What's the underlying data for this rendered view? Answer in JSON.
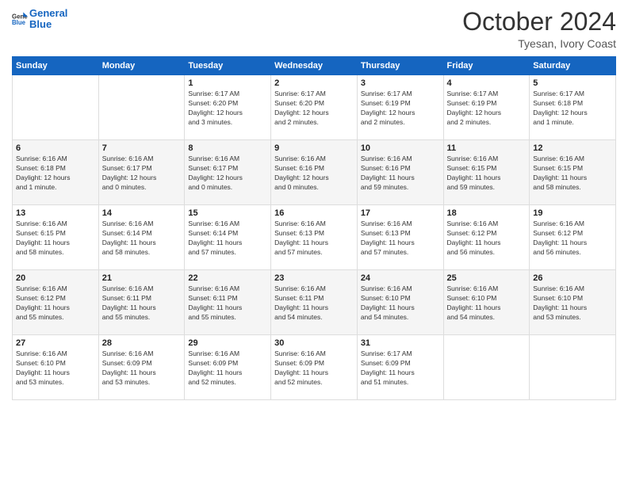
{
  "logo": {
    "line1": "General",
    "line2": "Blue"
  },
  "title": "October 2024",
  "location": "Tyesan, Ivory Coast",
  "weekdays": [
    "Sunday",
    "Monday",
    "Tuesday",
    "Wednesday",
    "Thursday",
    "Friday",
    "Saturday"
  ],
  "weeks": [
    [
      {
        "day": "",
        "info": ""
      },
      {
        "day": "",
        "info": ""
      },
      {
        "day": "1",
        "info": "Sunrise: 6:17 AM\nSunset: 6:20 PM\nDaylight: 12 hours\nand 3 minutes."
      },
      {
        "day": "2",
        "info": "Sunrise: 6:17 AM\nSunset: 6:20 PM\nDaylight: 12 hours\nand 2 minutes."
      },
      {
        "day": "3",
        "info": "Sunrise: 6:17 AM\nSunset: 6:19 PM\nDaylight: 12 hours\nand 2 minutes."
      },
      {
        "day": "4",
        "info": "Sunrise: 6:17 AM\nSunset: 6:19 PM\nDaylight: 12 hours\nand 2 minutes."
      },
      {
        "day": "5",
        "info": "Sunrise: 6:17 AM\nSunset: 6:18 PM\nDaylight: 12 hours\nand 1 minute."
      }
    ],
    [
      {
        "day": "6",
        "info": "Sunrise: 6:16 AM\nSunset: 6:18 PM\nDaylight: 12 hours\nand 1 minute."
      },
      {
        "day": "7",
        "info": "Sunrise: 6:16 AM\nSunset: 6:17 PM\nDaylight: 12 hours\nand 0 minutes."
      },
      {
        "day": "8",
        "info": "Sunrise: 6:16 AM\nSunset: 6:17 PM\nDaylight: 12 hours\nand 0 minutes."
      },
      {
        "day": "9",
        "info": "Sunrise: 6:16 AM\nSunset: 6:16 PM\nDaylight: 12 hours\nand 0 minutes."
      },
      {
        "day": "10",
        "info": "Sunrise: 6:16 AM\nSunset: 6:16 PM\nDaylight: 11 hours\nand 59 minutes."
      },
      {
        "day": "11",
        "info": "Sunrise: 6:16 AM\nSunset: 6:15 PM\nDaylight: 11 hours\nand 59 minutes."
      },
      {
        "day": "12",
        "info": "Sunrise: 6:16 AM\nSunset: 6:15 PM\nDaylight: 11 hours\nand 58 minutes."
      }
    ],
    [
      {
        "day": "13",
        "info": "Sunrise: 6:16 AM\nSunset: 6:15 PM\nDaylight: 11 hours\nand 58 minutes."
      },
      {
        "day": "14",
        "info": "Sunrise: 6:16 AM\nSunset: 6:14 PM\nDaylight: 11 hours\nand 58 minutes."
      },
      {
        "day": "15",
        "info": "Sunrise: 6:16 AM\nSunset: 6:14 PM\nDaylight: 11 hours\nand 57 minutes."
      },
      {
        "day": "16",
        "info": "Sunrise: 6:16 AM\nSunset: 6:13 PM\nDaylight: 11 hours\nand 57 minutes."
      },
      {
        "day": "17",
        "info": "Sunrise: 6:16 AM\nSunset: 6:13 PM\nDaylight: 11 hours\nand 57 minutes."
      },
      {
        "day": "18",
        "info": "Sunrise: 6:16 AM\nSunset: 6:12 PM\nDaylight: 11 hours\nand 56 minutes."
      },
      {
        "day": "19",
        "info": "Sunrise: 6:16 AM\nSunset: 6:12 PM\nDaylight: 11 hours\nand 56 minutes."
      }
    ],
    [
      {
        "day": "20",
        "info": "Sunrise: 6:16 AM\nSunset: 6:12 PM\nDaylight: 11 hours\nand 55 minutes."
      },
      {
        "day": "21",
        "info": "Sunrise: 6:16 AM\nSunset: 6:11 PM\nDaylight: 11 hours\nand 55 minutes."
      },
      {
        "day": "22",
        "info": "Sunrise: 6:16 AM\nSunset: 6:11 PM\nDaylight: 11 hours\nand 55 minutes."
      },
      {
        "day": "23",
        "info": "Sunrise: 6:16 AM\nSunset: 6:11 PM\nDaylight: 11 hours\nand 54 minutes."
      },
      {
        "day": "24",
        "info": "Sunrise: 6:16 AM\nSunset: 6:10 PM\nDaylight: 11 hours\nand 54 minutes."
      },
      {
        "day": "25",
        "info": "Sunrise: 6:16 AM\nSunset: 6:10 PM\nDaylight: 11 hours\nand 54 minutes."
      },
      {
        "day": "26",
        "info": "Sunrise: 6:16 AM\nSunset: 6:10 PM\nDaylight: 11 hours\nand 53 minutes."
      }
    ],
    [
      {
        "day": "27",
        "info": "Sunrise: 6:16 AM\nSunset: 6:10 PM\nDaylight: 11 hours\nand 53 minutes."
      },
      {
        "day": "28",
        "info": "Sunrise: 6:16 AM\nSunset: 6:09 PM\nDaylight: 11 hours\nand 53 minutes."
      },
      {
        "day": "29",
        "info": "Sunrise: 6:16 AM\nSunset: 6:09 PM\nDaylight: 11 hours\nand 52 minutes."
      },
      {
        "day": "30",
        "info": "Sunrise: 6:16 AM\nSunset: 6:09 PM\nDaylight: 11 hours\nand 52 minutes."
      },
      {
        "day": "31",
        "info": "Sunrise: 6:17 AM\nSunset: 6:09 PM\nDaylight: 11 hours\nand 51 minutes."
      },
      {
        "day": "",
        "info": ""
      },
      {
        "day": "",
        "info": ""
      }
    ]
  ]
}
